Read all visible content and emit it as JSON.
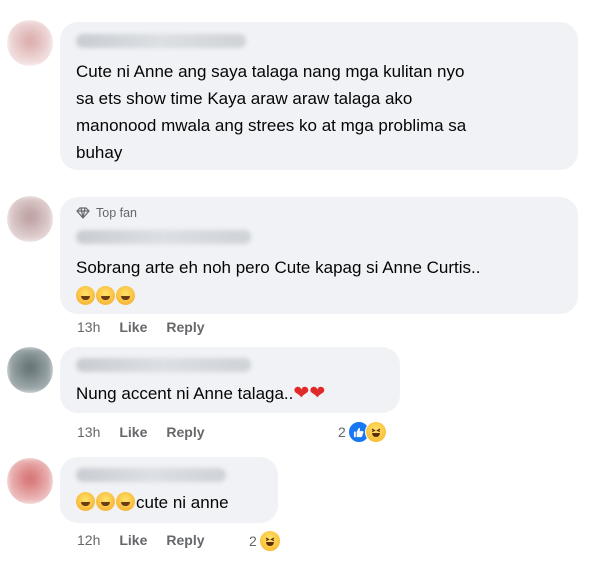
{
  "comments": [
    {
      "text_lines": [
        "Cute ni Anne ang saya talaga nang mga kulitan nyo",
        "sa ets show time Kaya araw araw talaga ako",
        "manonood mwala ang strees ko at mga problima sa",
        "buhay"
      ]
    },
    {
      "badge": "Top fan",
      "text": "Sobrang arte eh noh pero Cute kapag si Anne Curtis..",
      "emoji_line": [
        "grinning",
        "grinning",
        "laughing"
      ],
      "time": "13h",
      "like": "Like",
      "reply": "Reply"
    },
    {
      "text": "Nung accent ni Anne talaga..",
      "emojis": [
        "heart",
        "heart"
      ],
      "time": "13h",
      "like": "Like",
      "reply": "Reply",
      "reaction_count": "2",
      "reactions": [
        "like",
        "haha"
      ]
    },
    {
      "emojis": [
        "laughing",
        "laughing",
        "laughing"
      ],
      "text": "cute ni anne",
      "time": "12h",
      "like": "Like",
      "reply": "Reply",
      "reaction_count": "2",
      "reactions": [
        "haha"
      ]
    }
  ]
}
